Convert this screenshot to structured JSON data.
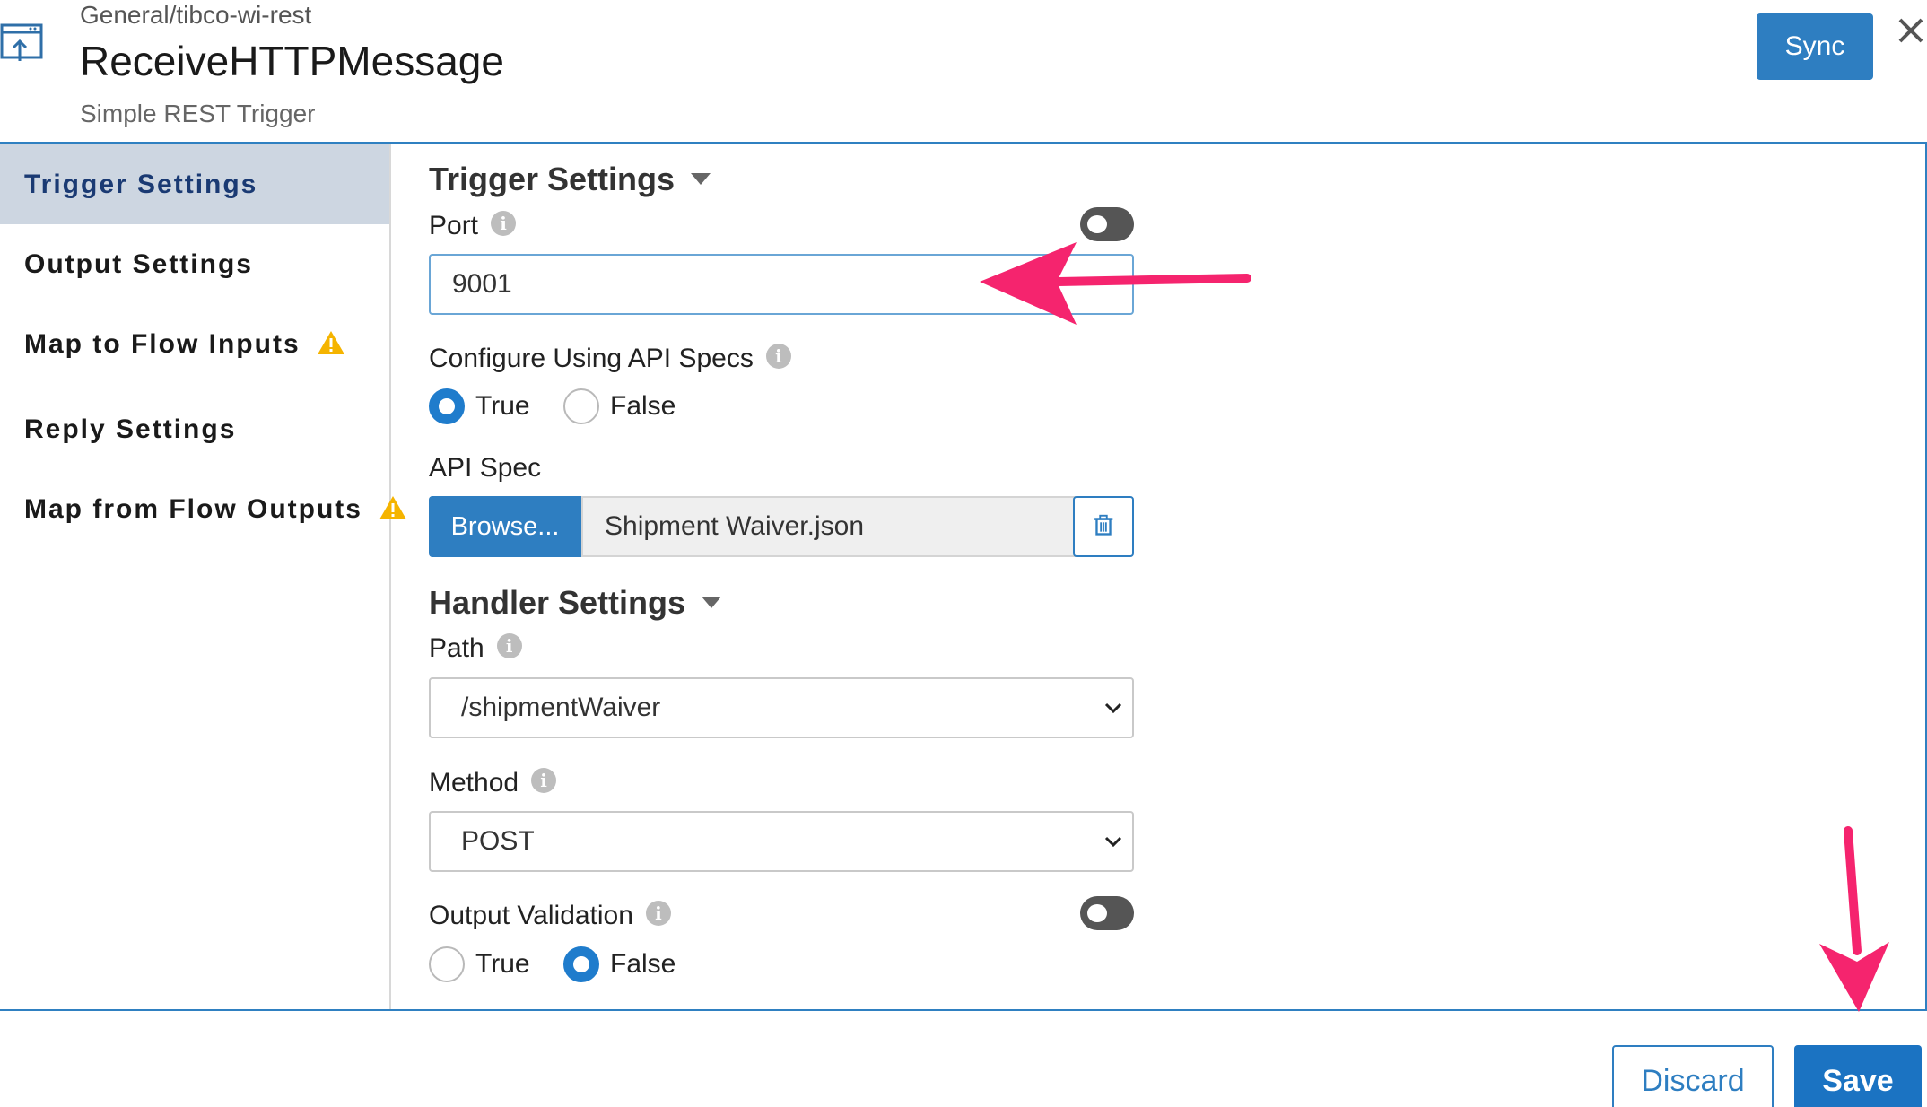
{
  "header": {
    "breadcrumb": "General/tibco-wi-rest",
    "title": "ReceiveHTTPMessage",
    "subtitle": "Simple REST Trigger",
    "sync_label": "Sync",
    "icon": "trigger-window-icon"
  },
  "sidebar": {
    "items": [
      {
        "label": "Trigger Settings",
        "active": true,
        "warning": false
      },
      {
        "label": "Output Settings",
        "active": false,
        "warning": false
      },
      {
        "label": "Map to Flow Inputs",
        "active": false,
        "warning": true
      },
      {
        "label": "Reply Settings",
        "active": false,
        "warning": false
      },
      {
        "label": "Map from Flow Outputs",
        "active": false,
        "warning": true
      }
    ]
  },
  "trigger_settings": {
    "title": "Trigger Settings",
    "port_label": "Port",
    "port_value": "9001",
    "configure_label": "Configure Using API Specs",
    "configure_options": [
      "True",
      "False"
    ],
    "configure_selected": "True",
    "api_spec_label": "API Spec",
    "browse_label": "Browse...",
    "api_spec_file": "Shipment Waiver.json"
  },
  "handler_settings": {
    "title": "Handler Settings",
    "path_label": "Path",
    "path_value": "/shipmentWaiver",
    "method_label": "Method",
    "method_value": "POST",
    "output_validation_label": "Output Validation",
    "output_validation_options": [
      "True",
      "False"
    ],
    "output_validation_selected": "False"
  },
  "footer": {
    "discard_label": "Discard",
    "save_label": "Save"
  },
  "colors": {
    "accent": "#2e7ec1",
    "sidebar_active_bg": "#cdd6e1",
    "annotation_arrow": "#f5246e",
    "warning": "#f5b400"
  }
}
